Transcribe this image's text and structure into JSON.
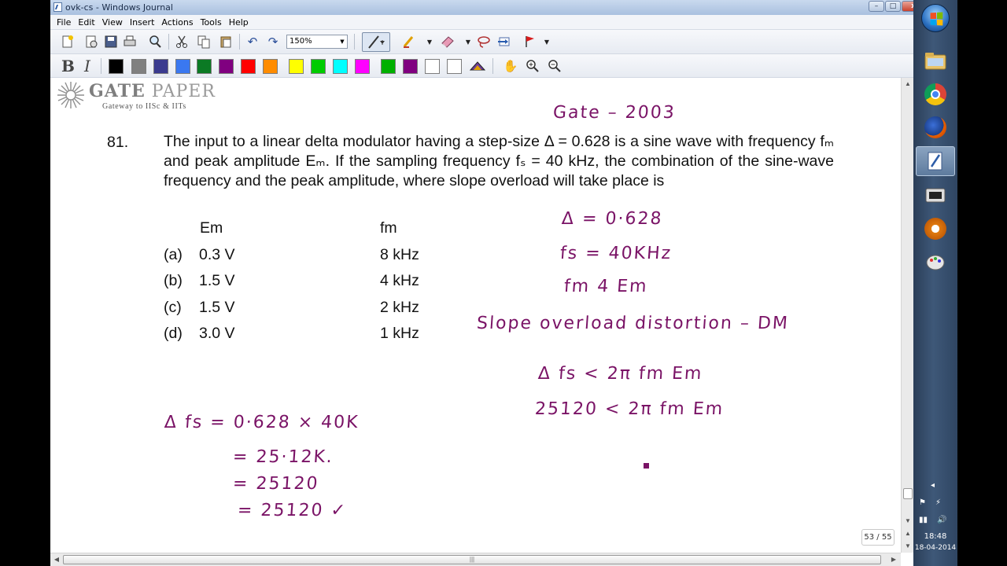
{
  "window": {
    "title": "ovk-cs - Windows Journal",
    "minimize": "–",
    "maximize": "□",
    "close": "x"
  },
  "menu": [
    "File",
    "Edit",
    "View",
    "Insert",
    "Actions",
    "Tools",
    "Help"
  ],
  "toolbar": {
    "zoom": "150%",
    "icons": [
      "new-note-icon",
      "open-icon",
      "save-icon",
      "print-icon",
      "find-icon",
      "cut-icon",
      "copy-icon",
      "paste-icon",
      "undo-icon",
      "redo-icon",
      "pen-icon",
      "highlighter-icon",
      "eraser-icon",
      "lasso-icon",
      "insert-space-icon",
      "flag-icon"
    ]
  },
  "format_toolbar": {
    "bold": "B",
    "italic": "I",
    "pen_colors": [
      "#000000",
      "#808080",
      "#3b3b8f",
      "#3a78f0",
      "#0b7a24",
      "#800080",
      "#ff0000",
      "#ff8c00",
      "#ffff00",
      "#00cc00",
      "#00ffff",
      "#ff00ff",
      "#00b000",
      "#800080",
      "#ffffff",
      "#ffffff"
    ],
    "tools": [
      "hand-icon",
      "zoom-in-icon",
      "zoom-out-icon"
    ]
  },
  "header": {
    "brand": "GATE PAPER",
    "brand_bold": "GATE",
    "brand_rest": "PAPER",
    "tagline": "Gateway to IISc & IITs"
  },
  "question": {
    "number": "81.",
    "text": "The input to a linear delta modulator having a step-size Δ = 0.628 is a sine wave with frequency fₘ and peak amplitude Eₘ. If the sampling frequency fₛ = 40 kHz, the combination of the sine-wave frequency and the peak amplitude, where slope overload will take place is",
    "col_em": "Em",
    "col_fm": "fm",
    "options": [
      {
        "label": "(a)",
        "em": "0.3 V",
        "fm": "8 kHz"
      },
      {
        "label": "(b)",
        "em": "1.5 V",
        "fm": "4 kHz"
      },
      {
        "label": "(c)",
        "em": "1.5 V",
        "fm": "2 kHz"
      },
      {
        "label": "(d)",
        "em": "3.0 V",
        "fm": "1 kHz"
      }
    ]
  },
  "ink": {
    "gate_year": "Gate – 2003",
    "delta": "Δ = 0·628",
    "fs": "fs = 40KHz",
    "fm_em": "fm 4 Em",
    "slope": "Slope overload distortion – DM",
    "cond1": "Δ fs  <  2π fm Em",
    "cond2": "25120  <  2π fm Em",
    "calc1": "Δ fs  =  0·628 × 40K",
    "calc2": "= 25·12K.",
    "calc3": "= 25120",
    "calc4": "= 25120 ✓"
  },
  "page_counter": "53 / 55",
  "tray": {
    "time": "18:48",
    "date": "18-04-2014"
  }
}
